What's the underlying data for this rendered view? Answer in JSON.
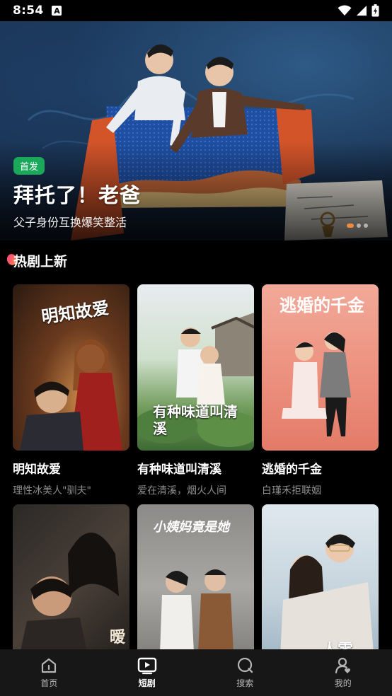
{
  "status_bar": {
    "time": "8:54",
    "notification_letter": "A"
  },
  "hero": {
    "badge": "首发",
    "title": "拜托了！老爸",
    "subtitle": "父子身份互换爆笑整活"
  },
  "section": {
    "title": "热剧上新"
  },
  "dramas": [
    {
      "title": "明知故爱",
      "desc": "理性冰美人\"驯夫\"",
      "poster_text": "明知故爱"
    },
    {
      "title": "有种味道叫清溪",
      "desc": "爱在清溪，烟火人间",
      "poster_text": "有种味道叫清溪"
    },
    {
      "title": "逃婚的千金",
      "desc": "白瑾禾拒联姻",
      "poster_text": "逃婚的千金"
    },
    {
      "title": "",
      "desc": "",
      "poster_text": "暧"
    },
    {
      "title": "",
      "desc": "",
      "poster_text": "小姨妈竟是她"
    },
    {
      "title": "",
      "desc": "",
      "poster_text": "人零"
    }
  ],
  "bottom_nav": [
    {
      "label": "首页",
      "icon": "home-icon"
    },
    {
      "label": "短剧",
      "icon": "play-icon"
    },
    {
      "label": "搜索",
      "icon": "search-icon"
    },
    {
      "label": "我的",
      "icon": "profile-icon"
    }
  ],
  "colors": {
    "badge_green": "#1aa85a",
    "accent_orange": "#f08a3c",
    "nav_bg": "#171717"
  }
}
